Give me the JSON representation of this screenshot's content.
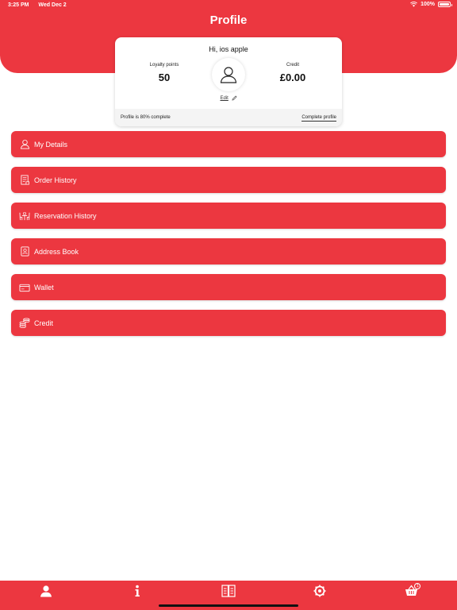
{
  "status_bar": {
    "time": "3:25 PM",
    "date": "Wed Dec 2",
    "battery": "100%"
  },
  "header": {
    "title": "Profile"
  },
  "profile": {
    "greeting": "Hi, ios apple",
    "loyalty_label": "Loyalty points",
    "loyalty_value": "50",
    "credit_label": "Credit",
    "credit_value": "£0.00",
    "edit_label": "Edit",
    "completion_text": "Profile is 80% complete",
    "complete_link": "Complete profile"
  },
  "menu": {
    "items": [
      {
        "label": "My Details",
        "icon": "person-icon"
      },
      {
        "label": "Order History",
        "icon": "receipt-icon"
      },
      {
        "label": "Reservation History",
        "icon": "table-icon"
      },
      {
        "label": "Address Book",
        "icon": "address-book-icon"
      },
      {
        "label": "Wallet",
        "icon": "card-icon"
      },
      {
        "label": "Credit",
        "icon": "coins-icon"
      }
    ]
  },
  "tab_bar": {
    "tabs": [
      {
        "icon": "profile-icon"
      },
      {
        "icon": "info-icon"
      },
      {
        "icon": "menu-book-icon"
      },
      {
        "icon": "settings-icon"
      },
      {
        "icon": "basket-icon",
        "badge": "1"
      }
    ]
  },
  "colors": {
    "accent": "#ec3740",
    "background": "#ffffff",
    "card_footer": "#f4f4f4"
  }
}
